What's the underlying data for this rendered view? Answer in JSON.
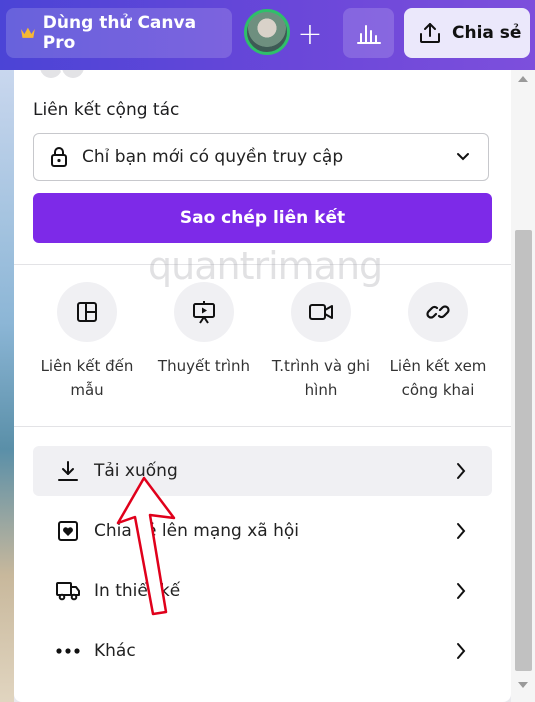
{
  "topbar": {
    "pro_label": "Dùng thử Canva Pro",
    "add_label": "+",
    "share_label": "Chia sẻ"
  },
  "panel": {
    "collab_title": "Liên kết cộng tác",
    "access_value": "Chỉ bạn mới có quyền truy cập",
    "copy_button": "Sao chép liên kết",
    "share_options": [
      {
        "label_line1": "Liên kết đến",
        "label_line2": "mẫu",
        "icon": "template-icon"
      },
      {
        "label_line1": "Thuyết trình",
        "label_line2": "",
        "icon": "presentation-icon"
      },
      {
        "label_line1": "T.trình và ghi",
        "label_line2": "hình",
        "icon": "video-camera-icon"
      },
      {
        "label_line1": "Liên kết xem",
        "label_line2": "công khai",
        "icon": "link-icon"
      }
    ],
    "menu": [
      {
        "label": "Tải xuống",
        "icon": "download-icon"
      },
      {
        "label": "Chia sẻ lên mạng xã hội",
        "icon": "heart-box-icon"
      },
      {
        "label": "In thiết kế",
        "icon": "truck-icon"
      },
      {
        "label": "Khác",
        "icon": "more-dots-icon"
      }
    ]
  },
  "watermark": "quantrimang",
  "colors": {
    "topbar_start": "#4b44d6",
    "topbar_end": "#7d4fdc",
    "accent_purple": "#7d2ae8",
    "annotation_red": "#e0001b"
  }
}
